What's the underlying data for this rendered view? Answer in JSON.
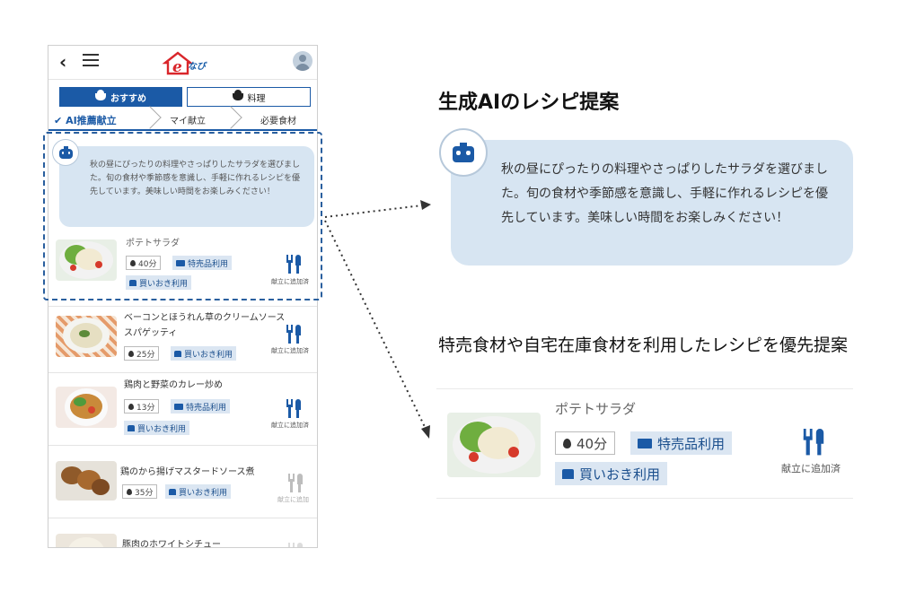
{
  "phone": {
    "back_glyph": "‹",
    "logo_text": "なび",
    "tabs": [
      {
        "label": "おすすめ",
        "active": true
      },
      {
        "label": "料理",
        "active": false
      }
    ],
    "steps": [
      {
        "label": "AI推薦献立",
        "check": "✔",
        "active": true
      },
      {
        "label": "マイ献立",
        "active": false
      },
      {
        "label": "必要食材",
        "active": false
      }
    ],
    "ai_message": "秋の昼にぴったりの料理やさっぱりしたサラダを選びました。旬の食材や季節感を意識し、手軽に作れるレシピを優先しています。美味しい時間をお楽しみください！",
    "recipes": [
      {
        "name": "ポテトサラダ",
        "time": "40分",
        "tags": [
          "特売品利用",
          "買いおき利用"
        ],
        "add_label": "献立に追加済",
        "added": true
      },
      {
        "name": "ベーコンとほうれん草のクリームソーススパゲッティ",
        "time": "25分",
        "tags": [
          "買いおき利用"
        ],
        "add_label": "献立に追加済",
        "added": true
      },
      {
        "name": "鶏肉と野菜のカレー炒め",
        "time": "13分",
        "tags": [
          "特売品利用",
          "買いおき利用"
        ],
        "add_label": "献立に追加済",
        "added": true
      },
      {
        "name": "鶏のから揚げマスタードソース煮",
        "time": "35分",
        "tags": [
          "買いおき利用"
        ],
        "add_label": "献立に追加",
        "added": false
      },
      {
        "name": "豚肉のホワイトシチュー",
        "added": false
      }
    ]
  },
  "callout_ai": {
    "heading": "生成AIのレシピ提案",
    "message": "秋の昼にぴったりの料理やさっぱりしたサラダを選びました。旬の食材や季節感を意識し、手軽に作れるレシピを優先しています。美味しい時間をお楽しみください！"
  },
  "callout_recipe": {
    "heading": "特売食材や自宅在庫食材を利用したレシピを優先提案",
    "name": "ポテトサラダ",
    "time": "40分",
    "tag1": "特売品利用",
    "tag2": "買いおき利用",
    "add_label": "献立に追加済"
  },
  "colors": {
    "accent": "#1b5aa6",
    "bubble": "#d7e5f2",
    "dashed": "#2a5f9e",
    "inactive_icon": "#b9b9b9"
  },
  "icons": [
    "back-icon",
    "menu-icon",
    "home-logo-icon",
    "avatar-icon",
    "pot-icon",
    "robot-icon",
    "timer-icon",
    "card-icon",
    "storage-icon",
    "fork-knife-icon"
  ]
}
